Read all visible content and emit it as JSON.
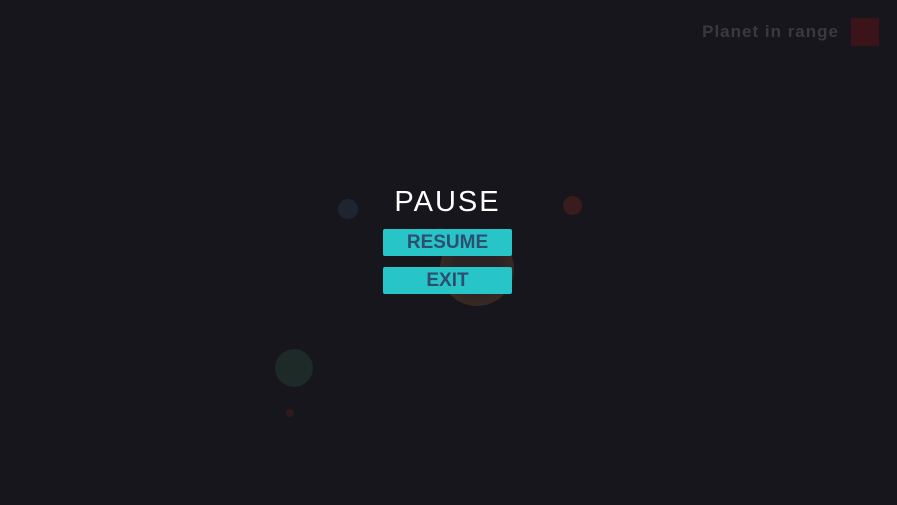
{
  "hud": {
    "label": "Planet in range",
    "indicator_color": "#3a1418"
  },
  "pause_menu": {
    "title": "PAUSE",
    "buttons": [
      {
        "label": "RESUME"
      },
      {
        "label": "EXIT"
      }
    ],
    "button_color": "#27c5c8",
    "button_text_color": "#2e4e6e"
  }
}
